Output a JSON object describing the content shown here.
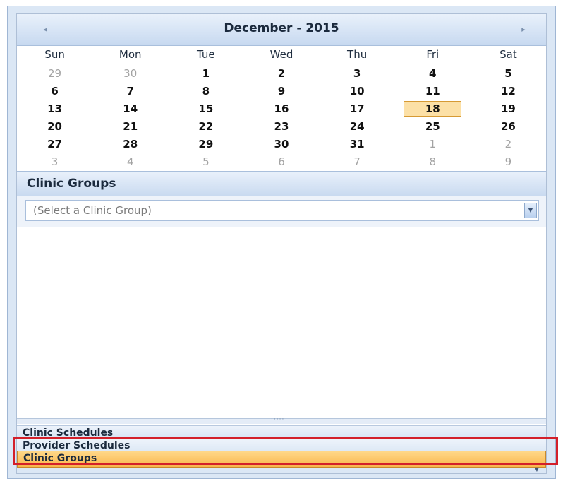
{
  "calendar": {
    "title": "December - 2015",
    "prev_arrow": "◂",
    "next_arrow": "▸",
    "day_names": [
      "Sun",
      "Mon",
      "Tue",
      "Wed",
      "Thu",
      "Fri",
      "Sat"
    ],
    "weeks": [
      [
        {
          "d": "29",
          "o": true
        },
        {
          "d": "30",
          "o": true
        },
        {
          "d": "1"
        },
        {
          "d": "2"
        },
        {
          "d": "3"
        },
        {
          "d": "4"
        },
        {
          "d": "5"
        }
      ],
      [
        {
          "d": "6"
        },
        {
          "d": "7"
        },
        {
          "d": "8"
        },
        {
          "d": "9"
        },
        {
          "d": "10"
        },
        {
          "d": "11"
        },
        {
          "d": "12"
        }
      ],
      [
        {
          "d": "13"
        },
        {
          "d": "14"
        },
        {
          "d": "15"
        },
        {
          "d": "16"
        },
        {
          "d": "17"
        },
        {
          "d": "18",
          "sel": true
        },
        {
          "d": "19"
        }
      ],
      [
        {
          "d": "20"
        },
        {
          "d": "21"
        },
        {
          "d": "22"
        },
        {
          "d": "23"
        },
        {
          "d": "24"
        },
        {
          "d": "25"
        },
        {
          "d": "26"
        }
      ],
      [
        {
          "d": "27"
        },
        {
          "d": "28"
        },
        {
          "d": "29"
        },
        {
          "d": "30"
        },
        {
          "d": "31"
        },
        {
          "d": "1",
          "o": true
        },
        {
          "d": "2",
          "o": true
        }
      ],
      [
        {
          "d": "3",
          "o": true
        },
        {
          "d": "4",
          "o": true
        },
        {
          "d": "5",
          "o": true
        },
        {
          "d": "6",
          "o": true
        },
        {
          "d": "7",
          "o": true
        },
        {
          "d": "8",
          "o": true
        },
        {
          "d": "9",
          "o": true
        }
      ]
    ],
    "selected_color": "#fce0a6"
  },
  "clinic_groups": {
    "header": "Clinic Groups",
    "select_placeholder": "(Select a Clinic Group)"
  },
  "nav": {
    "items": [
      "Clinic Schedules",
      "Provider Schedules",
      "Clinic Groups"
    ],
    "active": "Clinic Groups",
    "active_color": "#f9b64b",
    "highlight_color": "#d3202a"
  }
}
